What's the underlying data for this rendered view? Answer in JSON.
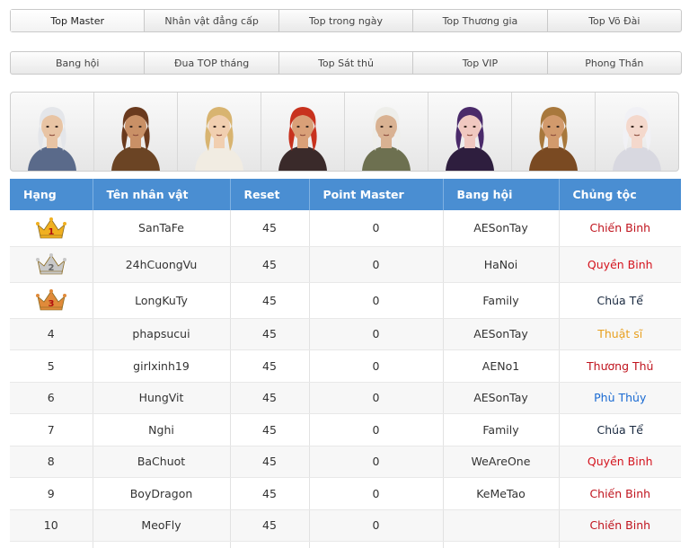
{
  "tabs_row1": [
    {
      "label": "Top Master",
      "active": true
    },
    {
      "label": "Nhân vật đẳng cấp"
    },
    {
      "label": "Top trong ngày"
    },
    {
      "label": "Top Thương gia"
    },
    {
      "label": "Top Võ Đài"
    }
  ],
  "tabs_row2": [
    {
      "label": "Bang hội"
    },
    {
      "label": "Đua TOP tháng"
    },
    {
      "label": "Top Sát thủ"
    },
    {
      "label": "Top VIP"
    },
    {
      "label": "Phong Thần"
    }
  ],
  "portraits": [
    {
      "name": "character-portrait-1",
      "hair": "#e4e6ea",
      "skin": "#e8c4a4",
      "outfit": "#5a6a8a"
    },
    {
      "name": "character-portrait-2",
      "hair": "#6a3a1e",
      "skin": "#c99066",
      "outfit": "#6b4424"
    },
    {
      "name": "character-portrait-3",
      "hair": "#d8b470",
      "skin": "#f1cfb0",
      "outfit": "#f1ece2"
    },
    {
      "name": "character-portrait-4",
      "hair": "#c8321e",
      "skin": "#d9a078",
      "outfit": "#3a2a2a"
    },
    {
      "name": "character-portrait-5",
      "hair": "#eeeeea",
      "skin": "#d9b292",
      "outfit": "#6d7050"
    },
    {
      "name": "character-portrait-6",
      "hair": "#4a2a6a",
      "skin": "#f0c8c0",
      "outfit": "#2e1e3e"
    },
    {
      "name": "character-portrait-7",
      "hair": "#a8783c",
      "skin": "#d29a6c",
      "outfit": "#7a4a22"
    },
    {
      "name": "character-portrait-8",
      "hair": "#f1f1f5",
      "skin": "#f4d8cc",
      "outfit": "#d8d8e0"
    }
  ],
  "table": {
    "headers": [
      "Hạng",
      "Tên nhân vật",
      "Reset",
      "Point Master",
      "Bang hội",
      "Chủng tộc"
    ],
    "medal_colors": {
      "gold": "#f0b020",
      "silver": "#c8c8c8",
      "bronze": "#e08a3a"
    },
    "race_colors": {
      "Chiến Binh": "#c0141e",
      "Quyền Binh": "#d4141e",
      "Chúa Tể": "#1a2a40",
      "Thuật sĩ": "#e8a020",
      "Thương Thủ": "#c0141e",
      "Phù Thủy": "#1a6ad2"
    },
    "rows": [
      {
        "rank": "1",
        "medal": "gold",
        "name": "SanTaFe",
        "reset": "45",
        "point": "0",
        "guild": "AESonTay",
        "race": "Chiến Binh"
      },
      {
        "rank": "2",
        "medal": "silver",
        "name": "24hCuongVu",
        "reset": "45",
        "point": "0",
        "guild": "HaNoi",
        "race": "Quyền Binh"
      },
      {
        "rank": "3",
        "medal": "bronze",
        "name": "LongKuTy",
        "reset": "45",
        "point": "0",
        "guild": "Family",
        "race": "Chúa Tể"
      },
      {
        "rank": "4",
        "name": "phapsucui",
        "reset": "45",
        "point": "0",
        "guild": "AESonTay",
        "race": "Thuật sĩ"
      },
      {
        "rank": "5",
        "name": "girlxinh19",
        "reset": "45",
        "point": "0",
        "guild": "AENo1",
        "race": "Thương Thủ"
      },
      {
        "rank": "6",
        "name": "HungVit",
        "reset": "45",
        "point": "0",
        "guild": "AESonTay",
        "race": "Phù Thủy"
      },
      {
        "rank": "7",
        "name": "Nghi",
        "reset": "45",
        "point": "0",
        "guild": "Family",
        "race": "Chúa Tể"
      },
      {
        "rank": "8",
        "name": "BaChuot",
        "reset": "45",
        "point": "0",
        "guild": "WeAreOne",
        "race": "Quyền Binh"
      },
      {
        "rank": "9",
        "name": "BoyDragon",
        "reset": "45",
        "point": "0",
        "guild": "KeMeTao",
        "race": "Chiến Binh"
      },
      {
        "rank": "10",
        "name": "MeoFly",
        "reset": "45",
        "point": "0",
        "guild": "",
        "race": "Chiến Binh"
      },
      {
        "rank": "",
        "name": "",
        "reset": "",
        "point": "",
        "guild": "",
        "race": ""
      }
    ]
  }
}
